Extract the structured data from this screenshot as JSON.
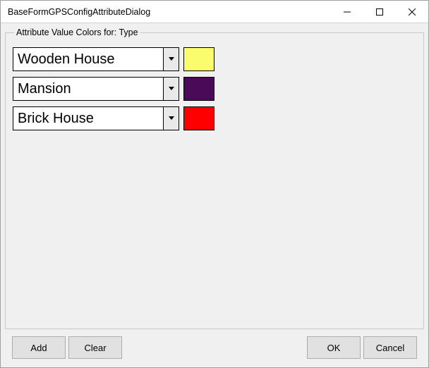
{
  "window": {
    "title": "BaseFormGPSConfigAttributeDialog"
  },
  "group": {
    "legend": "Attribute Value Colors for: Type"
  },
  "rows": [
    {
      "value": "Wooden House",
      "color": "#fbfb6e"
    },
    {
      "value": "Mansion",
      "color": "#4b0a57"
    },
    {
      "value": "Brick House",
      "color": "#ff0000"
    }
  ],
  "buttons": {
    "add": "Add",
    "clear": "Clear",
    "ok": "OK",
    "cancel": "Cancel"
  }
}
